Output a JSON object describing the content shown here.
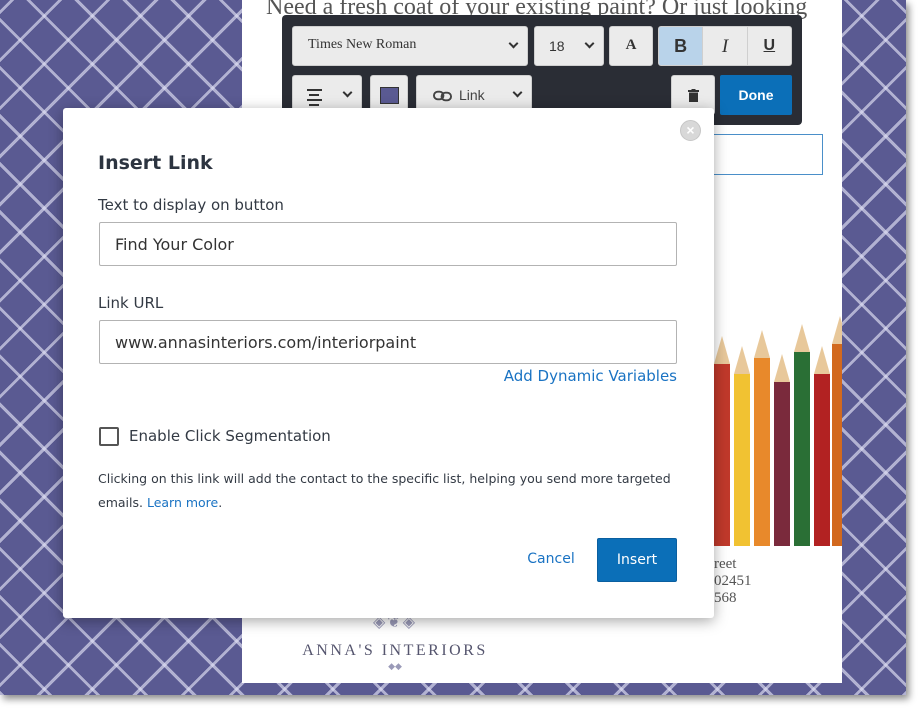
{
  "canvas": {
    "headline": "Need a fresh coat of your existing paint? Or just looking",
    "address_lines": [
      "reet",
      "02451",
      "568"
    ],
    "logo_name": "ANNA'S INTERIORS"
  },
  "toolbar": {
    "font_family": "Times New Roman",
    "font_size": "18",
    "font_color_label": "A",
    "bold_label": "B",
    "italic_label": "I",
    "underline_label": "U",
    "link_label": "Link",
    "done_label": "Done",
    "swatch_color": "#5a5a92",
    "accent_color": "#0b6fb8"
  },
  "modal": {
    "title": "Insert Link",
    "close_label": "×",
    "display_text_label": "Text to display on button",
    "display_text_value": "Find Your Color",
    "url_label": "Link URL",
    "url_value": "www.annasinteriors.com/interiorpaint",
    "dynamic_variables_link": "Add Dynamic Variables",
    "click_segmentation_label": "Enable Click Segmentation",
    "click_segmentation_checked": false,
    "help_text": "Clicking on this link will add the contact to the specific list, helping you send more targeted emails.",
    "learn_more": "Learn more",
    "cancel_label": "Cancel",
    "insert_label": "Insert"
  },
  "icons": [
    "chevron-down-icon",
    "align-icon",
    "link-icon",
    "trash-icon",
    "close-icon"
  ]
}
